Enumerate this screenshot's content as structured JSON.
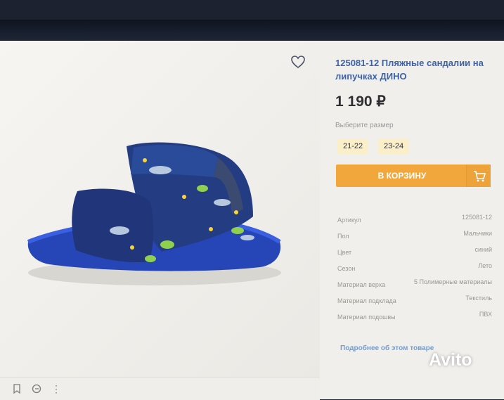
{
  "product": {
    "title": "125081-12 Пляжные сандалии на липучках ДИНО",
    "price": "1 190 ₽",
    "size_label": "Выберите размер",
    "sizes": [
      "21-22",
      "23-24"
    ],
    "cart_button": "В КОРЗИНУ",
    "more_link": "Подробнее об этом товаре"
  },
  "specs": [
    {
      "key": "Артикул",
      "value": "125081-12"
    },
    {
      "key": "Пол",
      "value": "Мальчики"
    },
    {
      "key": "Цвет",
      "value": "синий"
    },
    {
      "key": "Сезон",
      "value": "Лето"
    },
    {
      "key": "Материал верха",
      "value": "5 Полимерные материалы"
    },
    {
      "key": "Материал подклада",
      "value": "Текстиль"
    },
    {
      "key": "Материал подошвы",
      "value": "ПВХ"
    }
  ],
  "watermark": "Avito",
  "colors": {
    "accent": "#f2a73d",
    "title": "#3d62a8",
    "size_bg": "#fbefc9",
    "sandal": "#264f9b"
  },
  "icons": [
    "heart-icon",
    "bookmark-icon",
    "share-icon",
    "more-icon",
    "cart-icon"
  ]
}
